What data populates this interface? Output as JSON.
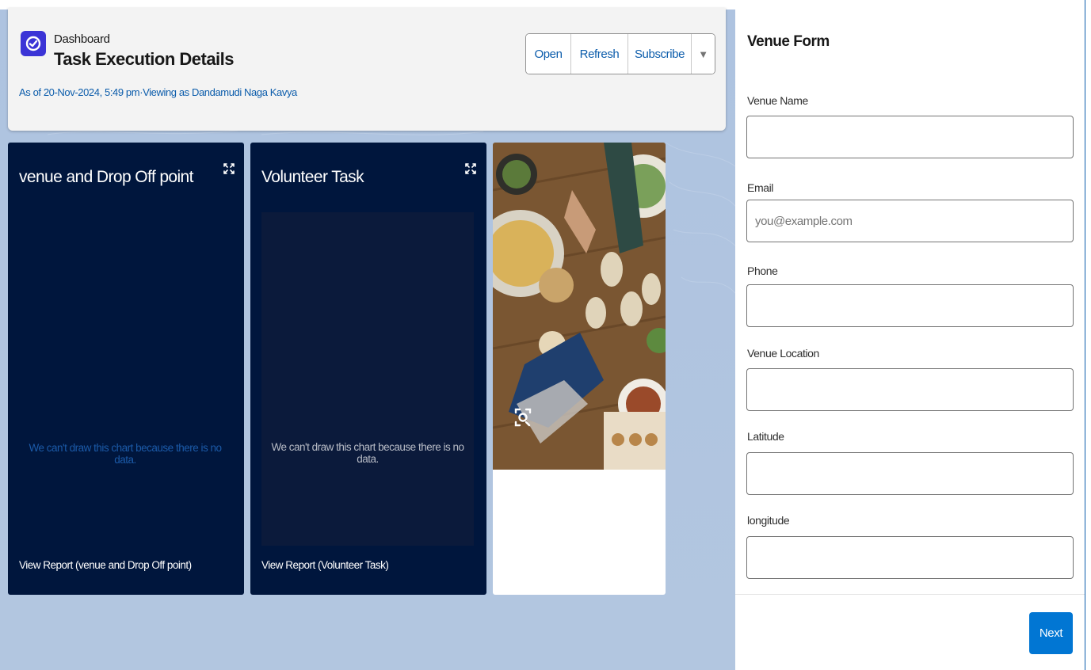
{
  "header": {
    "kicker": "Dashboard",
    "title": "Task Execution Details",
    "subtitle": "As of 20-Nov-2024, 5:49 pm·Viewing as Dandamudi Naga Kavya",
    "buttons": {
      "open": "Open",
      "refresh": "Refresh",
      "subscribe": "Subscribe",
      "more": "▼"
    }
  },
  "widgets": [
    {
      "title": "venue and Drop Off point",
      "empty_message": "We can't draw this chart because there is no data.",
      "link": "View Report (venue and Drop Off point)"
    },
    {
      "title": "Volunteer Task",
      "empty_message": "We can't draw this chart because there is no data.",
      "link": "View Report (Volunteer Task)"
    }
  ],
  "form": {
    "title": "Venue Form",
    "fields": [
      {
        "label": "Venue Name",
        "value": "",
        "placeholder": ""
      },
      {
        "label": "Email",
        "value": "",
        "placeholder": "you@example.com"
      },
      {
        "label": "Phone",
        "value": "",
        "placeholder": ""
      },
      {
        "label": "Venue Location",
        "value": "",
        "placeholder": ""
      },
      {
        "label": "Latitude",
        "value": "",
        "placeholder": ""
      },
      {
        "label": "longitude",
        "value": "",
        "placeholder": ""
      }
    ],
    "next_label": "Next"
  },
  "colors": {
    "brand_blue": "#0176d3",
    "link_blue": "#0b5cab",
    "widget_bg": "#00163d",
    "app_icon": "#3b34d6"
  }
}
